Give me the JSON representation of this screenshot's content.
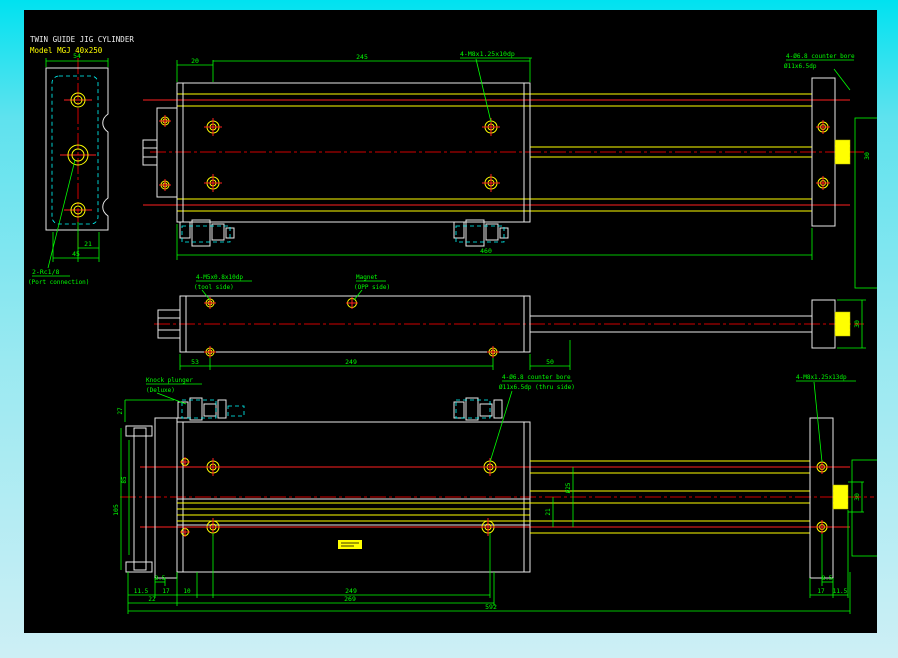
{
  "title_block": {
    "line1": "TWIN GUIDE JIG CYLINDER",
    "line2": "Model  MGJ 40x250"
  },
  "palette": {
    "background": "#000000",
    "frame_top": "#00e2f0",
    "frame_bottom": "#cdeff5",
    "geometry": "#e8e8e8",
    "detail": "#ffff00",
    "centerline": "#ff2020",
    "dimension": "#00ff00",
    "hidden_line": "#00ffff"
  },
  "end_view": {
    "dim_width": "54",
    "dim_21": "21",
    "dim_45": "45",
    "port_note_1": "2-Rc1/8",
    "port_note_2": "(Port connection)"
  },
  "top_view": {
    "dim_20": "20",
    "dim_245": "245",
    "dim_460": "460",
    "tap_note": "4-M8x1.25x10dp",
    "cbore_note_1": "4-Ø6.8 counter bore",
    "cbore_note_2": "Ø11x6.5dp",
    "dim_30": "30"
  },
  "side_view": {
    "tap_note_1": "4-M5x0.8x10dp",
    "tap_note_2": "(tool side)",
    "magnet_note_1": "Magnet",
    "magnet_note_2": "(OPP side)",
    "dim_53": "53",
    "dim_249": "249",
    "dim_50": "50",
    "dim_30": "30"
  },
  "bottom_view": {
    "knock_note_1": "Knock plunger",
    "knock_note_2": "(Deluxe)",
    "cbore_note_1": "4-Ø6.8 counter bore",
    "cbore_note_2": "Ø11x6.5dp (thru side)",
    "tap_note": "4-M8x1.25x13dp",
    "dim_27": "27",
    "dim_105": "105",
    "dim_85": "85",
    "dim_21": "21",
    "dim_dia_25": "Ø25",
    "dim_30": "30",
    "dim_8_5_left": "8.5",
    "dim_11_5_left": "11.5",
    "dim_17_left": "17",
    "dim_10": "10",
    "dim_22": "22",
    "dim_249": "249",
    "dim_269": "269",
    "dim_592": "592",
    "dim_8_5_right": "8.5",
    "dim_17_right": "17",
    "dim_11_5_right": "11.5"
  }
}
